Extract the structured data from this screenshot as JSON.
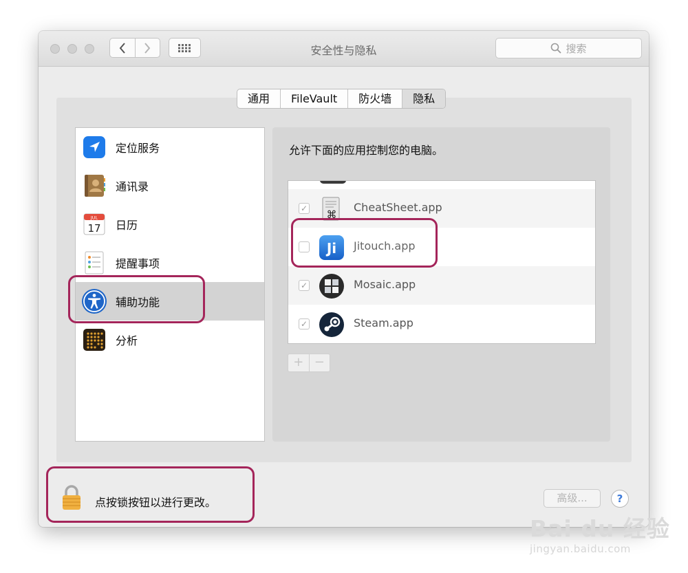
{
  "window": {
    "title": "安全性与隐私"
  },
  "toolbar": {
    "back_icon": "chevron-left",
    "forward_icon": "chevron-right",
    "grid_icon": "grid-icon"
  },
  "search": {
    "placeholder": "搜索"
  },
  "tabs": [
    {
      "label": "通用",
      "active": false
    },
    {
      "label": "FileVault",
      "active": false
    },
    {
      "label": "防火墙",
      "active": false
    },
    {
      "label": "隐私",
      "active": true
    }
  ],
  "sidebar": {
    "items": [
      {
        "label": "定位服务",
        "icon": "location-icon"
      },
      {
        "label": "通讯录",
        "icon": "contacts-icon"
      },
      {
        "label": "日历",
        "icon": "calendar-icon",
        "icon_month": "JUL",
        "icon_day": "17"
      },
      {
        "label": "提醒事项",
        "icon": "reminders-icon"
      },
      {
        "label": "辅助功能",
        "icon": "accessibility-icon",
        "selected": true
      },
      {
        "label": "分析",
        "icon": "analytics-icon"
      }
    ]
  },
  "main": {
    "description": "允许下面的应用控制您的电脑。",
    "apps": [
      {
        "name": "CheatSheet.app",
        "checked": true,
        "icon": "cheatsheet-icon"
      },
      {
        "name": "Jitouch.app",
        "checked": false,
        "icon": "jitouch-icon",
        "icon_text": "Ji"
      },
      {
        "name": "Mosaic.app",
        "checked": true,
        "icon": "mosaic-icon"
      },
      {
        "name": "Steam.app",
        "checked": true,
        "icon": "steam-icon"
      }
    ],
    "add_label": "+",
    "remove_label": "−"
  },
  "footer": {
    "lock_text": "点按锁按钮以进行更改。",
    "advanced_label": "高级...",
    "help_label": "?"
  },
  "watermark": {
    "logo": "Bai du 经验",
    "url": "jingyan.baidu.com"
  },
  "colors": {
    "highlight": "#a4255a",
    "accent": "#1f7ae0"
  }
}
